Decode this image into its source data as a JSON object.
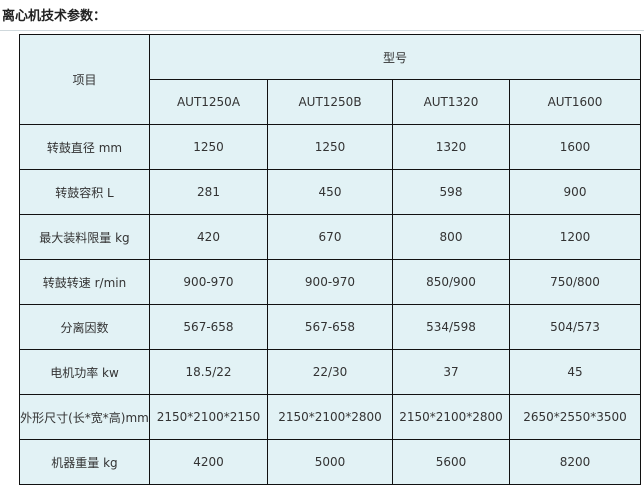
{
  "page": {
    "heading": "离心机技术参数："
  },
  "table": {
    "item_header": "项目",
    "model_header": "型号",
    "models": [
      "AUT1250A",
      "AUT1250B",
      "AUT1320",
      "AUT1600"
    ],
    "rows": [
      {
        "label": "转鼓直径 mm",
        "values": [
          "1250",
          "1250",
          "1320",
          "1600"
        ]
      },
      {
        "label": "转鼓容积 L",
        "values": [
          "281",
          "450",
          "598",
          "900"
        ]
      },
      {
        "label": "最大装料限量 kg",
        "values": [
          "420",
          "670",
          "800",
          "1200"
        ]
      },
      {
        "label": "转鼓转速 r/min",
        "values": [
          "900-970",
          "900-970",
          "850/900",
          "750/800"
        ]
      },
      {
        "label": "分离因数",
        "values": [
          "567-658",
          "567-658",
          "534/598",
          "504/573"
        ]
      },
      {
        "label": "电机功率 kw",
        "values": [
          "18.5/22",
          "22/30",
          "37",
          "45"
        ]
      },
      {
        "label": "外形尺寸(长*宽*高)mm",
        "values": [
          "2150*2100*2150",
          "2150*2100*2800",
          "2150*2100*2800",
          "2650*2550*3500"
        ]
      },
      {
        "label": "机器重量 kg",
        "values": [
          "4200",
          "5000",
          "5600",
          "8200"
        ]
      }
    ]
  }
}
